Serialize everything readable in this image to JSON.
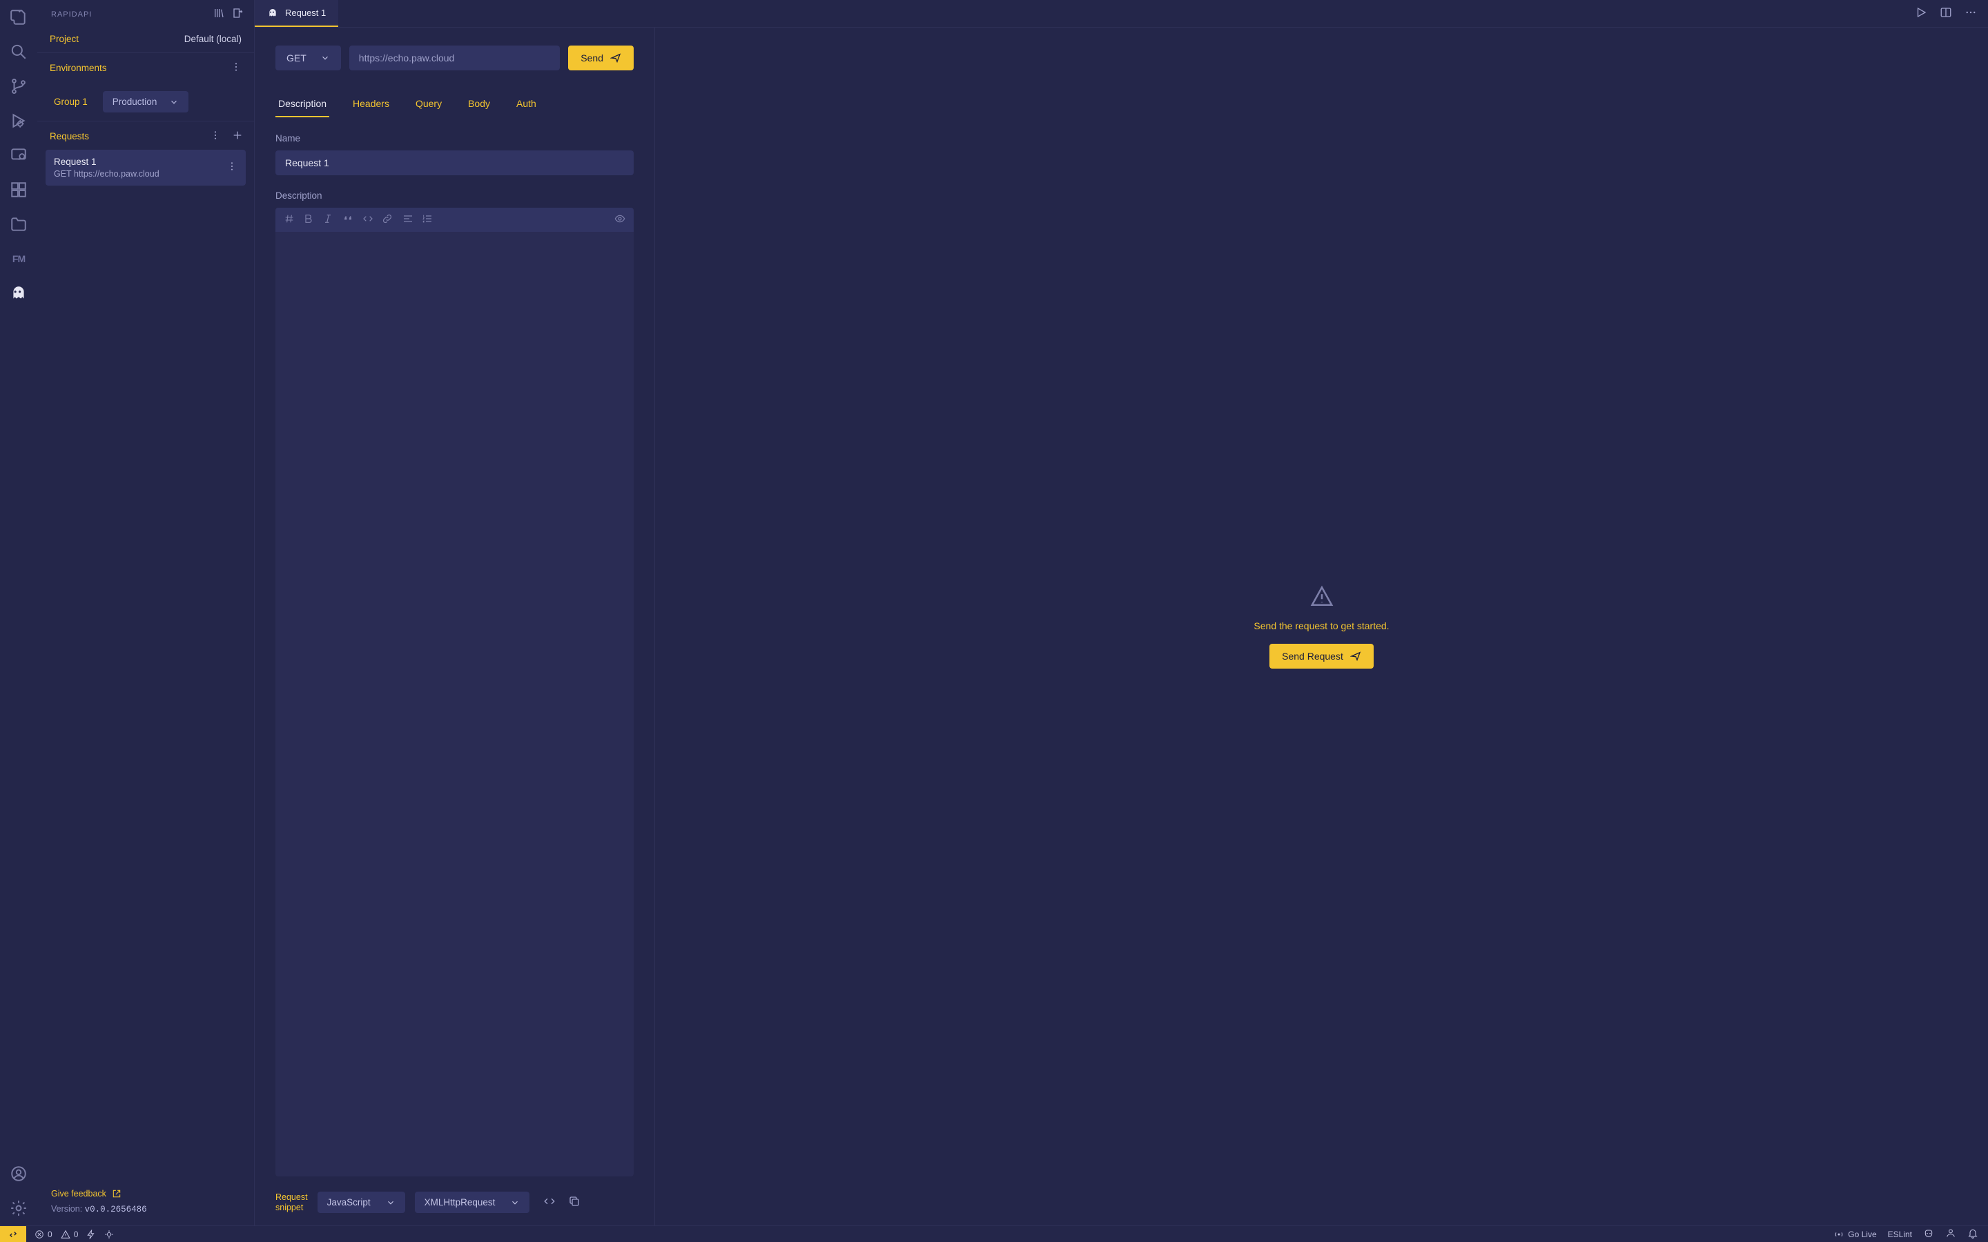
{
  "sidebar": {
    "title": "RAPIDAPI",
    "project_label": "Project",
    "project_value": "Default (local)",
    "environments_label": "Environments",
    "env_group": "Group 1",
    "env_selected": "Production",
    "requests_label": "Requests",
    "request": {
      "name": "Request 1",
      "method": "GET",
      "url": "https://echo.paw.cloud"
    },
    "feedback": "Give feedback",
    "version_prefix": "Version: ",
    "version": "v0.0.2656486"
  },
  "tab": {
    "title": "Request 1"
  },
  "request_bar": {
    "method": "GET",
    "url_placeholder": "https://echo.paw.cloud",
    "send": "Send"
  },
  "desc_tabs": [
    "Description",
    "Headers",
    "Query",
    "Body",
    "Auth"
  ],
  "fields": {
    "name_label": "Name",
    "name_value": "Request 1",
    "description_label": "Description"
  },
  "response_panel": {
    "message": "Send the request to get started.",
    "button": "Send Request"
  },
  "snippet": {
    "label1": "Request",
    "label2": "snippet",
    "lang": "JavaScript",
    "lib": "XMLHttpRequest"
  },
  "status": {
    "errors": "0",
    "warnings": "0",
    "golive": "Go Live",
    "eslint": "ESLint"
  }
}
